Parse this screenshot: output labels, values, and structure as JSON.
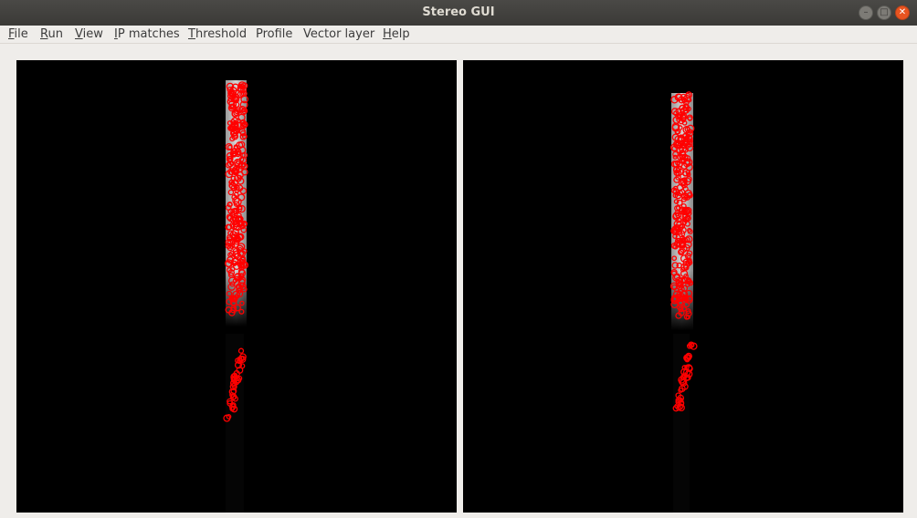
{
  "window": {
    "title": "Stereo GUI",
    "buttons": [
      "minimize",
      "maximize",
      "close"
    ]
  },
  "menu": [
    {
      "mnemonic": "F",
      "rest": "ile"
    },
    {
      "mnemonic": "R",
      "rest": "un"
    },
    {
      "mnemonic": "V",
      "rest": "iew"
    },
    {
      "mnemonic": "I",
      "rest": "P matches"
    },
    {
      "mnemonic": "T",
      "rest": "hreshold"
    },
    {
      "mnemonic": "",
      "rest": "Profile"
    },
    {
      "mnemonic": "",
      "rest": "Vector layer"
    },
    {
      "mnemonic": "H",
      "rest": "elp"
    }
  ],
  "icons": {
    "minimize": "minimize-icon",
    "maximize": "maximize-icon",
    "close": "close-icon"
  },
  "colors": {
    "titlebar": "#3c3b37",
    "close_button": "#e95420",
    "viewer_background": "#000000",
    "ip_match_marker": "#ff0000"
  },
  "images": [
    {
      "name": "left-image"
    },
    {
      "name": "right-image"
    }
  ]
}
